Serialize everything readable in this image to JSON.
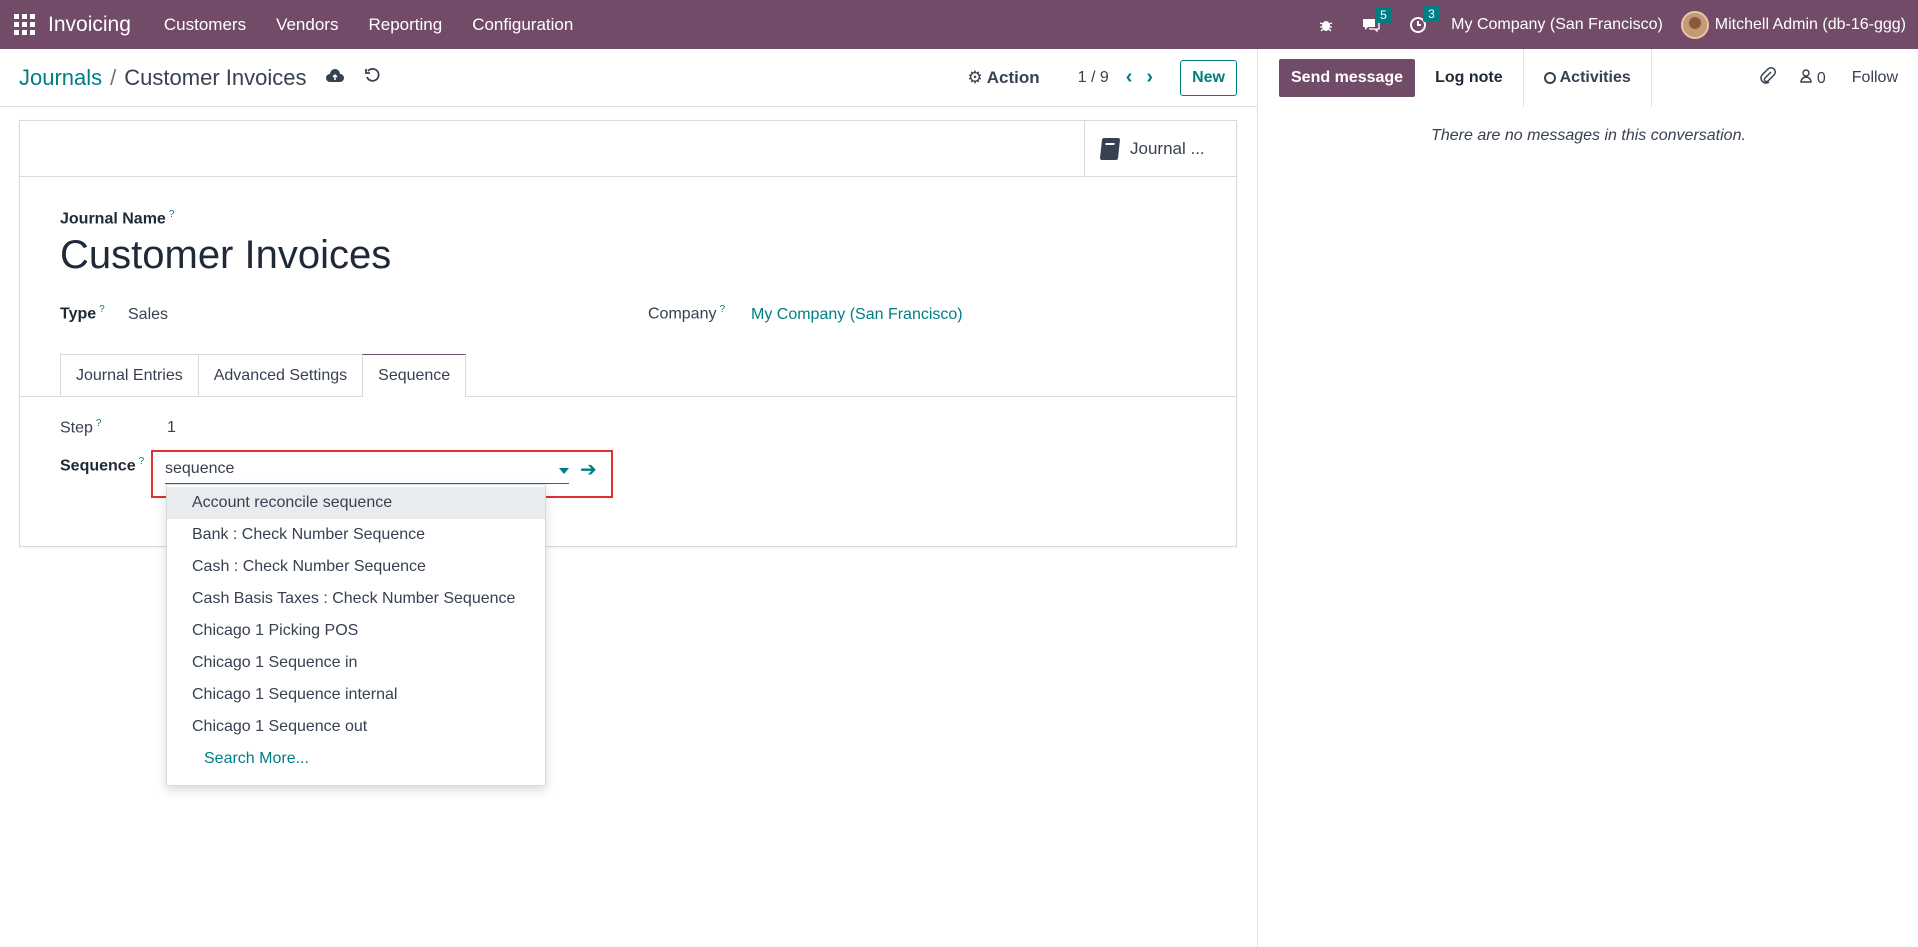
{
  "topnav": {
    "app_name": "Invoicing",
    "menu": [
      "Customers",
      "Vendors",
      "Reporting",
      "Configuration"
    ],
    "messages_count": "5",
    "activities_count": "3",
    "company": "My Company (San Francisco)",
    "user": "Mitchell Admin (db-16-ggg)",
    "brand_color": "#714B67"
  },
  "control_panel": {
    "breadcrumb_parent": "Journals",
    "breadcrumb_separator": "/",
    "breadcrumb_current": "Customer Invoices",
    "action_label": "Action",
    "pager": "1 / 9",
    "new_label": "New"
  },
  "form": {
    "smart_button": "Journal ...",
    "journal_name_label": "Journal Name",
    "journal_name": "Customer Invoices",
    "type_label": "Type",
    "type_value": "Sales",
    "company_label": "Company",
    "company_value": "My Company (San Francisco)",
    "tabs": [
      "Journal Entries",
      "Advanced Settings",
      "Sequence"
    ],
    "active_tab": "Sequence",
    "help_mark": "?",
    "step_label": "Step",
    "step_value": "1",
    "sequence_label": "Sequence",
    "sequence_input": "sequence"
  },
  "dropdown": {
    "items": [
      "Account reconcile sequence",
      "Bank : Check Number Sequence",
      "Cash : Check Number Sequence",
      "Cash Basis Taxes : Check Number Sequence",
      "Chicago 1 Picking POS",
      "Chicago 1 Sequence in",
      "Chicago 1 Sequence internal",
      "Chicago 1 Sequence out"
    ],
    "search_more": "Search More..."
  },
  "chatter": {
    "send_message": "Send message",
    "log_note": "Log note",
    "activities": "Activities",
    "followers_count": "0",
    "follow": "Follow",
    "empty_text": "There are no messages in this conversation."
  },
  "accent_color": "#017e84"
}
